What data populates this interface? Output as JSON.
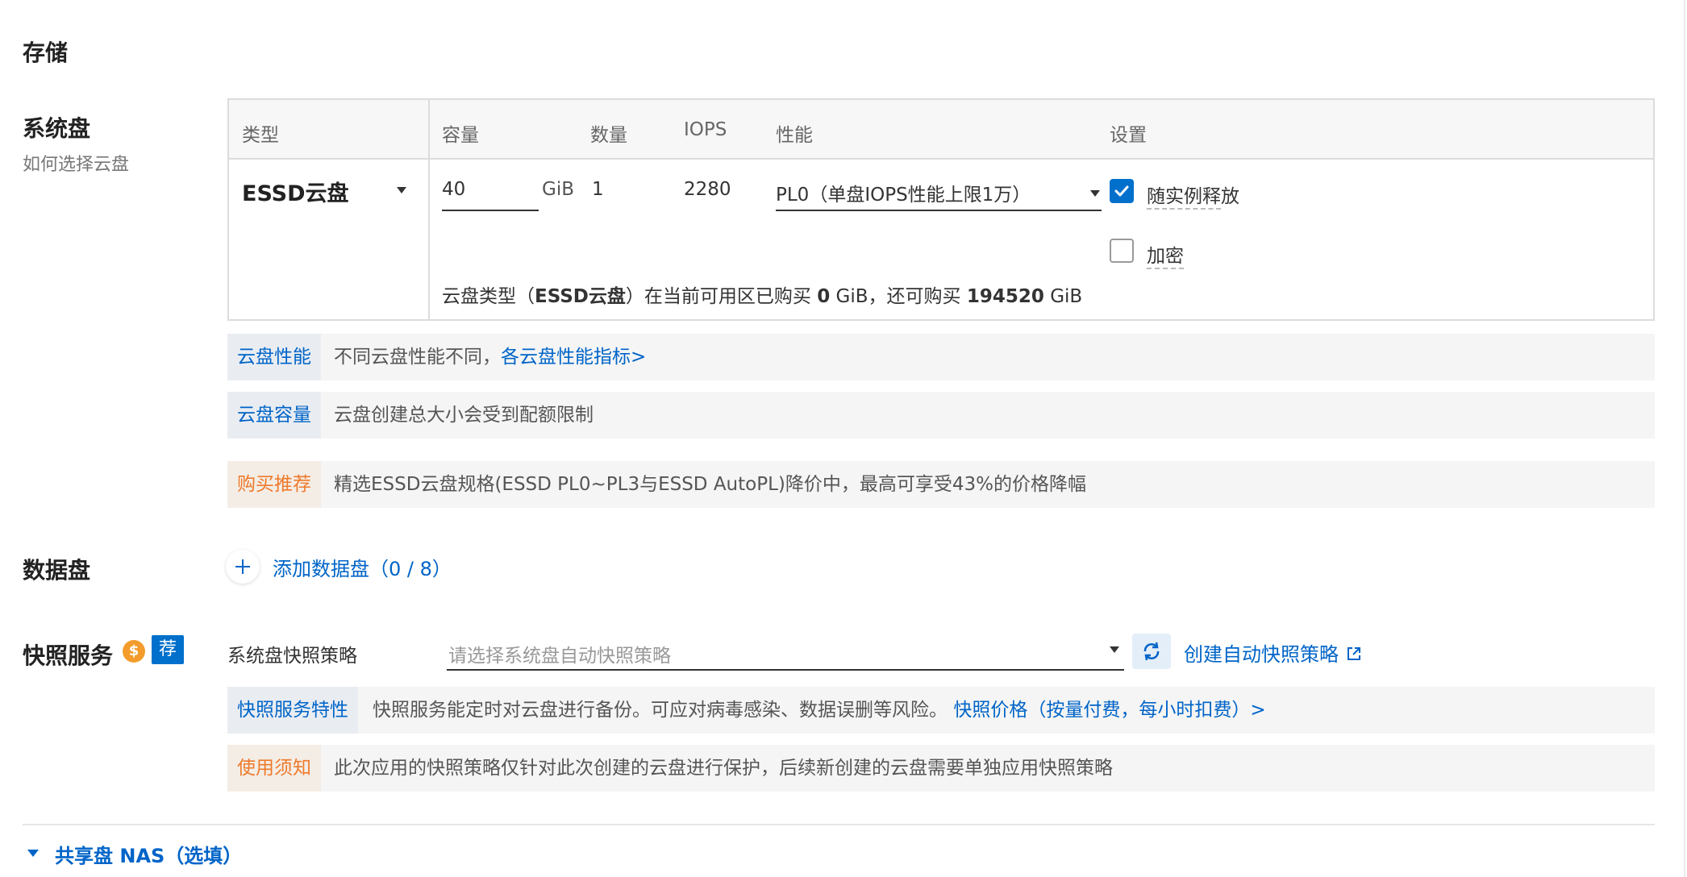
{
  "page": {
    "title": "存储"
  },
  "system_disk": {
    "title": "系统盘",
    "help_link": "如何选择云盘",
    "columns": [
      "类型",
      "容量",
      "数量",
      "IOPS",
      "性能",
      "设置"
    ],
    "type_value": "ESSD云盘",
    "capacity": "40",
    "capacity_unit": "GiB",
    "quantity": "1",
    "iops": "2280",
    "performance": "PL0（单盘IOPS性能上限1万）",
    "release_with_instance_label": "随实例释放",
    "release_with_instance_checked": true,
    "encrypt_label": "加密",
    "encrypt_checked": false,
    "quota_text_prefix": "云盘类型（",
    "quota_type_bold": "ESSD云盘",
    "quota_text_mid": "）在当前可用区已购买 ",
    "quota_bought": "0",
    "quota_text_mid2": " GiB，还可购买 ",
    "quota_remaining": "194520",
    "quota_text_suffix": " GiB"
  },
  "info_rows": {
    "performance": {
      "label": "云盘性能",
      "text": "不同云盘性能不同，",
      "link": "各云盘性能指标>"
    },
    "capacity": {
      "label": "云盘容量",
      "text": "云盘创建总大小会受到配额限制"
    },
    "recommend": {
      "label": "购买推荐",
      "text": "精选ESSD云盘规格(ESSD PL0~PL3与ESSD AutoPL)降价中，最高可享受43%的价格降幅"
    }
  },
  "data_disk": {
    "title": "数据盘",
    "add_label": "添加数据盘（0 / 8）"
  },
  "snapshot": {
    "title": "快照服务",
    "coin_badge": "$",
    "recommend_badge": "荐",
    "policy_label": "系统盘快照策略",
    "policy_placeholder": "请选择系统盘自动快照策略",
    "create_link": "创建自动快照策略",
    "feature_label": "快照服务特性",
    "feature_text": "快照服务能定时对云盘进行备份。可应对病毒感染、数据误删等风险。",
    "feature_link": "快照价格（按量付费，每小时扣费）>",
    "notice_label": "使用须知",
    "notice_text": "此次应用的快照策略仅针对此次创建的云盘进行保护，后续新创建的云盘需要单独应用快照策略"
  },
  "nas": {
    "title": "共享盘 NAS（选填）"
  },
  "colors": {
    "link_blue": "#0064c8",
    "checkbox_blue": "#0070cc",
    "warning_orange": "#ee7a2b",
    "coin_orange": "#f39c2b"
  }
}
